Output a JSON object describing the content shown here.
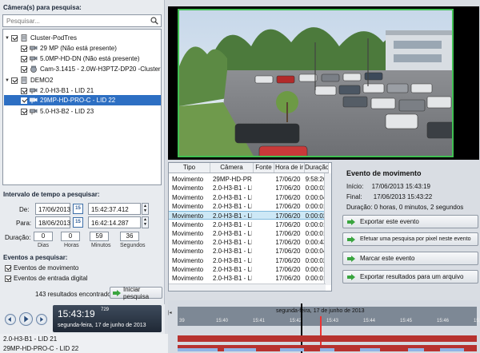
{
  "camera_search": {
    "title": "Câmera(s) para pesquisa:",
    "search_placeholder": "Pesquisar...",
    "tree": [
      {
        "label": "Cluster-PodTres",
        "level": 0,
        "type": "server",
        "checked": true,
        "expanded": true
      },
      {
        "label": "29 MP (Não está presente)",
        "level": 1,
        "type": "camera",
        "checked": true
      },
      {
        "label": "5.0MP-HD-DN (Não está presente)",
        "level": 1,
        "type": "camera",
        "checked": true
      },
      {
        "label": "Cam-3.1415 - 2.0W-H3PTZ-DP20 -Cluster Pod",
        "level": 1,
        "type": "camera",
        "checked": true
      },
      {
        "label": "DEMO2",
        "level": 0,
        "type": "server",
        "checked": true,
        "expanded": true
      },
      {
        "label": "2.0-H3-B1 - LID 21",
        "level": 1,
        "type": "camera",
        "checked": true
      },
      {
        "label": "29MP-HD-PRO-C - LID 22",
        "level": 1,
        "type": "camera",
        "checked": true,
        "selected": true
      },
      {
        "label": "5.0-H3-B2 - LID 23",
        "level": 1,
        "type": "camera",
        "checked": true
      }
    ]
  },
  "time_range": {
    "title": "Intervalo de tempo a pesquisar:",
    "from_label": "De:",
    "from_date": "17/06/2013",
    "from_time": "15:42:37.412",
    "to_label": "Para:",
    "to_date": "18/06/2013",
    "to_time": "16:42:14.287",
    "calendar_badge": "15",
    "duration_label": "Duração:",
    "duration": [
      {
        "value": "0",
        "unit": "Dias"
      },
      {
        "value": "0",
        "unit": "Horas"
      },
      {
        "value": "59",
        "unit": "Minutos"
      },
      {
        "value": "36",
        "unit": "Segundos"
      }
    ]
  },
  "events": {
    "title": "Eventos a pesquisar:",
    "motion_label": "Eventos de movimento",
    "motion_checked": true,
    "digital_label": "Eventos de entrada digital",
    "digital_checked": true,
    "results_count_text": "143  resultados encontrados",
    "start_button": "Iniciar pesquisa"
  },
  "results_table": {
    "columns": [
      "Tipo",
      "Câmera",
      "Fonte",
      "Hora de ir",
      "Duração"
    ],
    "rows": [
      [
        "Movimento",
        "29MP-HD-PR",
        "",
        "17/06/20",
        "9:58:26"
      ],
      [
        "Movimento",
        "2.0-H3-B1 - LI",
        "",
        "17/06/20",
        "0:00:02"
      ],
      [
        "Movimento",
        "2.0-H3-B1 - LI",
        "",
        "17/06/20",
        "0:00:04"
      ],
      [
        "Movimento",
        "2.0-H3-B1 - LI",
        "",
        "17/06/20",
        "0:00:01"
      ],
      [
        "Movimento",
        "2.0-H3-B1 - LI",
        "",
        "17/06/20",
        "0:00:02"
      ],
      [
        "Movimento",
        "2.0-H3-B1 - LI",
        "",
        "17/06/20",
        "0:00:01"
      ],
      [
        "Movimento",
        "2.0-H3-B1 - LI",
        "",
        "17/06/20",
        "0:00:01"
      ],
      [
        "Movimento",
        "2.0-H3-B1 - LI",
        "",
        "17/06/20",
        "0:00:43"
      ],
      [
        "Movimento",
        "2.0-H3-B1 - LI",
        "",
        "17/06/20",
        "0:00:04"
      ],
      [
        "Movimento",
        "2.0-H3-B1 - LI",
        "",
        "17/06/20",
        "0:00:02"
      ],
      [
        "Movimento",
        "2.0-H3-B1 - LI",
        "",
        "17/06/20",
        "0:00:01"
      ],
      [
        "Movimento",
        "2.0-H3-B1 - LI",
        "",
        "17/06/20",
        "0:00:01"
      ],
      [
        "Movimento",
        "2.0-H3-B1 - LI",
        "",
        "17/06/20",
        "0:00:05"
      ]
    ],
    "selected_row": 4
  },
  "event_detail": {
    "title": "Evento de movimento",
    "start_label": "Início:",
    "start_value": "17/06/2013 15:43:19",
    "end_label": "Final:",
    "end_value": "17/06/2013 15:43:22",
    "duration_text": "Duração: 0 horas, 0 minutos, 2 segundos",
    "actions": [
      "Exportar este evento",
      "Efetuar uma pesquisa por pixel neste evento",
      "Marcar este evento",
      "Exportar resultados para um arquivo"
    ]
  },
  "player": {
    "time": "15:43:19",
    "millis": "729",
    "date": "segunda-feira, 17 de junho de 2013"
  },
  "timeline": {
    "date_label": "segunda-feira, 17 de junho de 2013",
    "ticks": [
      "39",
      "15:40",
      "15:41",
      "15:42",
      "15:43",
      "15:44",
      "15:45",
      "15:46",
      "15:47"
    ],
    "lanes": [
      "2.0-H3-B1 - LID 21",
      "29MP-HD-PRO-C - LID 22"
    ]
  },
  "colors": {
    "selection": "#2d6fc3",
    "row_selected": "#cde8f6",
    "video_border": "#41c053",
    "timeline_record": "#b7322f",
    "timeline_motion": "#8fb4e6"
  }
}
